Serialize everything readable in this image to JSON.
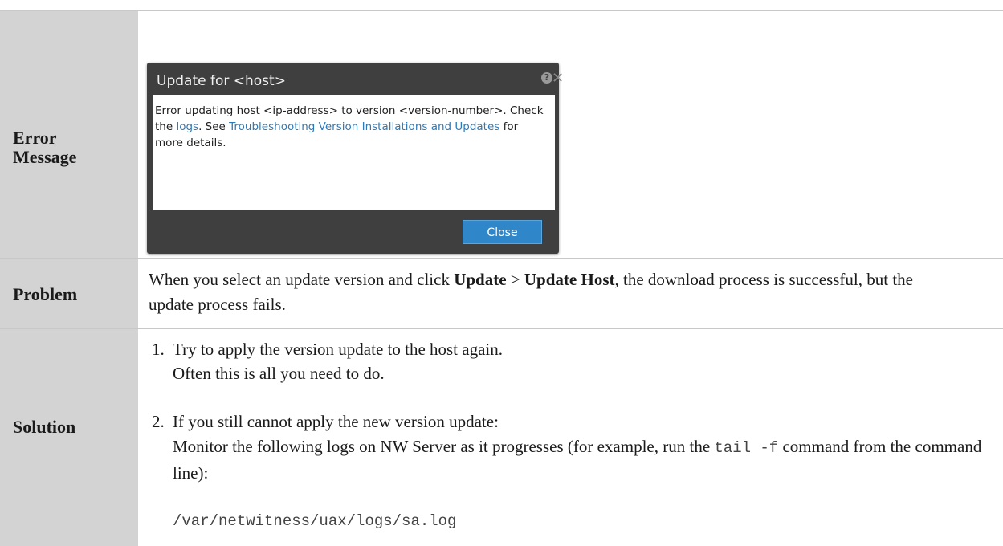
{
  "rows": {
    "error": {
      "label": "Error Message"
    },
    "problem": {
      "label": "Problem",
      "text_before": "When you select an update version and click ",
      "bold1": "Update",
      "arrow": " > ",
      "bold2": "Update Host",
      "text_after": ", the download process is successful, but the update process fails."
    },
    "solution": {
      "label": "Solution",
      "step1_num": "1.",
      "step1_line1": "Try to apply the version update to the host again.",
      "step1_line2": "Often this is all you need to do.",
      "step2_num": "2.",
      "step2_line1": "If you still cannot apply the new version update:",
      "step2_line2_a": "Monitor the following logs on NW Server as it progresses (for example, run the ",
      "step2_code1": "tail -f",
      "step2_line2_b": " command from the command line):",
      "step2_path": "/var/netwitness/uax/logs/sa.log"
    }
  },
  "dialog": {
    "title": "Update for <host>",
    "help_icon": "help-icon",
    "close_icon": "close-icon",
    "message_part1": "Error updating host <ip-address> to version <version-number>. Check the ",
    "logs_link": "logs",
    "message_part2": ".  See ",
    "troubleshooting_link": "Troubleshooting Version Installations and Updates",
    "message_part3": " for more details.",
    "close_button": "Close"
  }
}
